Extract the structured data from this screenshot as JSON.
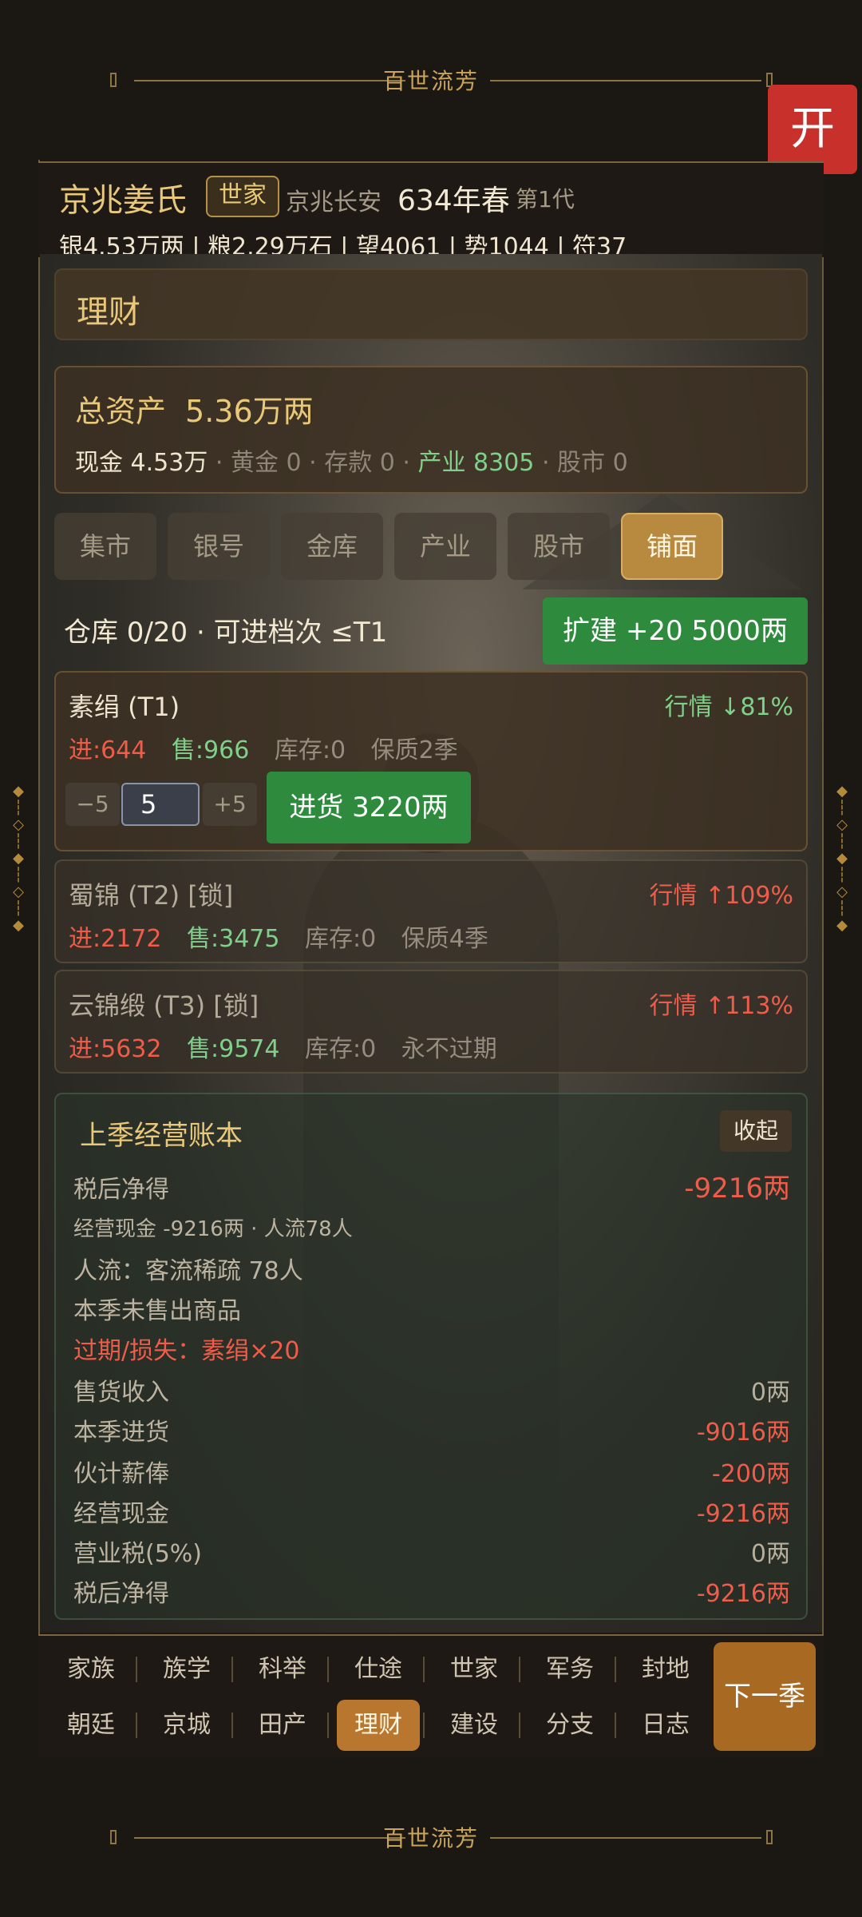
{
  "banner_title": "百世流芳",
  "open_button": "开",
  "status": {
    "clan_name": "京兆姜氏",
    "badge": "世家",
    "location": "京兆长安",
    "year": "634年春",
    "generation": "第1代",
    "resources": "银4.53万两 | 粮2.29万石 | 望4061 | 势1044 | 符37"
  },
  "section_title": "理财",
  "assets": {
    "label": "总资产",
    "value": "5.36万两",
    "cash": "现金 4.53万",
    "gold": "黄金 0",
    "deposit": "存款 0",
    "industry": "产业 8305",
    "stock": "股市 0",
    "dot": "·"
  },
  "tabs": [
    "集市",
    "银号",
    "金库",
    "产业",
    "股市",
    "铺面"
  ],
  "warehouse": {
    "text": "仓库 0/20 · 可进档次 ≤T1",
    "expand_label": "扩建 +20 5000两"
  },
  "goods": [
    {
      "name": "素绢 (T1)",
      "market": "行情 ↓81%",
      "buy": "进:644",
      "sell": "售:966",
      "stock": "库存:0",
      "shelf": "保质2季"
    },
    {
      "name": "蜀锦 (T2) [锁]",
      "market": "行情 ↑109%",
      "buy": "进:2172",
      "sell": "售:3475",
      "stock": "库存:0",
      "shelf": "保质4季"
    },
    {
      "name": "云锦缎 (T3) [锁]",
      "market": "行情 ↑113%",
      "buy": "进:5632",
      "sell": "售:9574",
      "stock": "库存:0",
      "shelf": "永不过期"
    }
  ],
  "purchase": {
    "minus": "−5",
    "qty": "5",
    "plus": "+5",
    "buy_label": "进货 3220两"
  },
  "ledger": {
    "title": "上季经营账本",
    "collapse": "收起",
    "net_label": "税后净得",
    "net_value": "-9216两",
    "summary": "经营现金 -9216两 · 人流78人",
    "traffic": "人流：客流稀疏 78人",
    "no_sales": "本季未售出商品",
    "loss": "过期/损失：素绢×20",
    "rows": [
      {
        "label": "售货收入",
        "value": "0两"
      },
      {
        "label": "本季进货",
        "value": "-9016两"
      },
      {
        "label": "伙计薪俸",
        "value": "-200两"
      },
      {
        "label": "经营现金",
        "value": "-9216两"
      },
      {
        "label": "营业税(5%)",
        "value": "0两"
      },
      {
        "label": "税后净得",
        "value": "-9216两"
      }
    ]
  },
  "nav": {
    "row1": [
      "家族",
      "族学",
      "科举",
      "仕途",
      "世家",
      "军务",
      "封地"
    ],
    "row2": [
      "朝廷",
      "京城",
      "田产",
      "理财",
      "建设",
      "分支",
      "日志"
    ],
    "next": "下一季"
  }
}
